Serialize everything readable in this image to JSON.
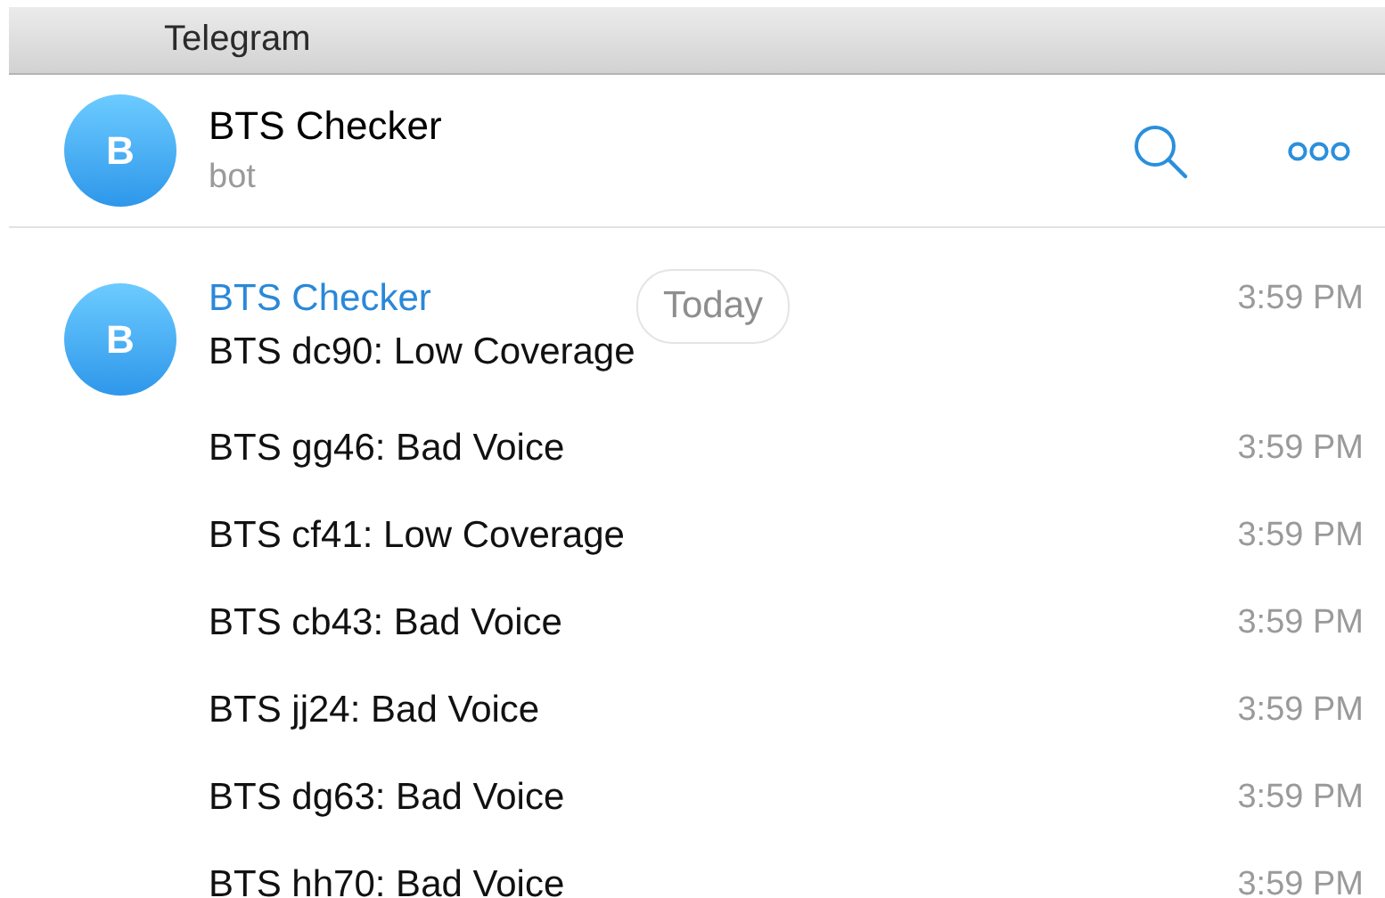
{
  "window": {
    "title": "Telegram"
  },
  "chat_header": {
    "avatar_letter": "B",
    "name": "BTS Checker",
    "status": "bot"
  },
  "date_badge": "Today",
  "messages": [
    {
      "sender": "BTS Checker",
      "avatar_letter": "B",
      "text": "BTS dc90: Low Coverage",
      "time": "3:59 PM"
    },
    {
      "text": "BTS gg46: Bad Voice",
      "time": "3:59 PM"
    },
    {
      "text": "BTS cf41: Low Coverage",
      "time": "3:59 PM"
    },
    {
      "text": "BTS cb43: Bad Voice",
      "time": "3:59 PM"
    },
    {
      "text": "BTS jj24: Bad Voice",
      "time": "3:59 PM"
    },
    {
      "text": "BTS dg63: Bad Voice",
      "time": "3:59 PM"
    },
    {
      "text": "BTS hh70: Bad Voice",
      "time": "3:59 PM"
    }
  ]
}
